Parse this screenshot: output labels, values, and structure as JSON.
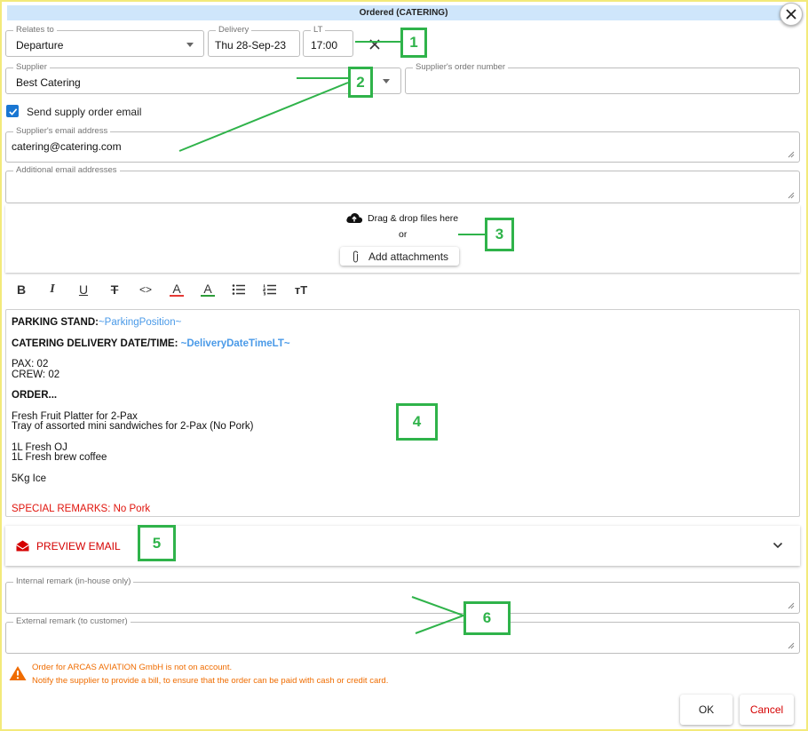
{
  "dialog": {
    "title": "Ordered (CATERING)"
  },
  "relates_to": {
    "label": "Relates to",
    "value": "Departure"
  },
  "delivery": {
    "label": "Delivery",
    "value": "Thu 28-Sep-23"
  },
  "lt": {
    "label": "LT",
    "value": "17:00"
  },
  "supplier": {
    "label": "Supplier",
    "value": "Best Catering"
  },
  "supplier_order_number": {
    "label": "Supplier's order number",
    "value": ""
  },
  "send_email": {
    "label": "Send supply order email",
    "checked": true
  },
  "supplier_email": {
    "label": "Supplier's email address",
    "value": "catering@catering.com"
  },
  "additional_emails": {
    "label": "Additional email addresses",
    "value": ""
  },
  "dropzone": {
    "drag_text": "Drag & drop files here",
    "or_text": "or",
    "button_label": "Add attachments"
  },
  "toolbar": {
    "items": [
      "bold",
      "italic",
      "underline",
      "strikethrough",
      "code",
      "font-color",
      "highlight-color",
      "bullet-list",
      "numbered-list",
      "text-size"
    ],
    "bold_glyph": "B",
    "italic_glyph": "I",
    "underline_glyph": "U",
    "strike_glyph": "T",
    "code_glyph": "<>",
    "fontcolor_glyph": "A",
    "highlight_glyph": "A",
    "textsize_glyph": "тT"
  },
  "editor": {
    "parking_label": "PARKING STAND:",
    "parking_var": "~ParkingPosition~",
    "delivery_label": "CATERING DELIVERY DATE/TIME:",
    "delivery_var": "~DeliveryDateTimeLT~",
    "pax": "PAX:  02",
    "crew": "CREW: 02",
    "order": "ORDER...",
    "item1": "Fresh Fruit Platter for 2-Pax",
    "item2": "Tray of assorted mini sandwiches for 2-Pax (No Pork)",
    "item3": "1L Fresh OJ",
    "item4": "1L Fresh brew coffee",
    "item5": "5Kg Ice",
    "remarks": "SPECIAL REMARKS: No Pork"
  },
  "preview": {
    "label": "PREVIEW EMAIL"
  },
  "internal_remark": {
    "label": "Internal remark (in-house only)",
    "value": ""
  },
  "external_remark": {
    "label": "External remark (to customer)",
    "value": ""
  },
  "warning": {
    "line1": "Order for ARCAS AVIATION GmbH is not on account.",
    "line2": "Notify the supplier to provide a bill, to ensure that the order can be paid with cash or credit card."
  },
  "buttons": {
    "ok": "OK",
    "cancel": "Cancel"
  },
  "annotations": [
    "1",
    "2",
    "3",
    "4",
    "5",
    "6"
  ],
  "colors": {
    "accent": "#1976d2",
    "annotation": "#2fb34a",
    "danger": "#d50000",
    "warning": "#ef6c00",
    "variable": "#4a9ae8",
    "titlebar": "#cfe6fb"
  }
}
